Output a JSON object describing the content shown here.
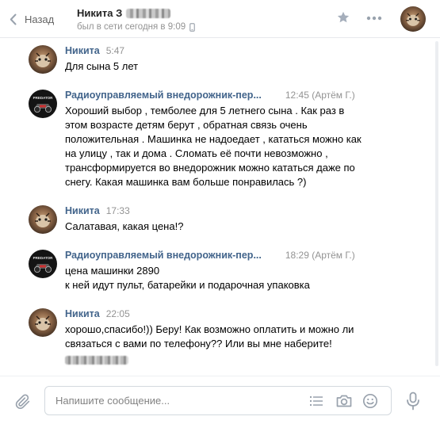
{
  "header": {
    "back_label": "Назад",
    "peer_name": "Никита З",
    "status": "был в сети сегодня в 9:09"
  },
  "messages": [
    {
      "author": "Никита",
      "time": "5:47",
      "avatar": "animal-photo-avatar",
      "lines": [
        "Для сына 5 лет"
      ]
    },
    {
      "author": "Радиоуправляемый внедорожник-пер...",
      "time": "12:45 (Артём Г.)",
      "avatar": "predator-car-logo",
      "lines": [
        "Хороший выбор , темболее для 5 летнего сына . Как раз в",
        "этом возрасте детям берут , обратная связь очень",
        "положительная . Машинка не надоедает , кататься можно как",
        "на улицу , так и дома . Сломать её почти невозможно ,",
        "трансформируется во внедорожник можно кататься даже по",
        "снегу. Какая машинка вам больше понравилась ?)"
      ]
    },
    {
      "author": "Никита",
      "time": "17:33",
      "avatar": "animal-photo-avatar",
      "lines": [
        "Салатавая, какая цена!?"
      ]
    },
    {
      "author": "Радиоуправляемый внедорожник-пер...",
      "time": "18:29 (Артём Г.)",
      "avatar": "predator-car-logo",
      "lines": [
        "цена машинки 2890",
        "к ней идут пульт, батарейки и подарочная упаковка"
      ]
    },
    {
      "author": "Никита",
      "time": "22:05",
      "avatar": "animal-photo-avatar",
      "lines": [
        "хорошо,спасибо!)) Беру! Как возможно оплатить и можно ли",
        "связаться с вами по телефону?? Или вы мне наберите!"
      ]
    }
  ],
  "composer": {
    "placeholder": "Напишите сообщение..."
  },
  "icons": {
    "back": "chevron-left-icon",
    "star": "star-icon",
    "more": "more-dots-icon",
    "mobile": "mobile-phone-icon",
    "attach": "paperclip-icon",
    "templates": "list-icon",
    "camera": "camera-icon",
    "emoji": "smile-icon",
    "voice": "microphone-icon"
  },
  "colors": {
    "author": "#42648b",
    "meta": "#939393",
    "icon": "#99a2ad",
    "border": "#d3d9de"
  }
}
